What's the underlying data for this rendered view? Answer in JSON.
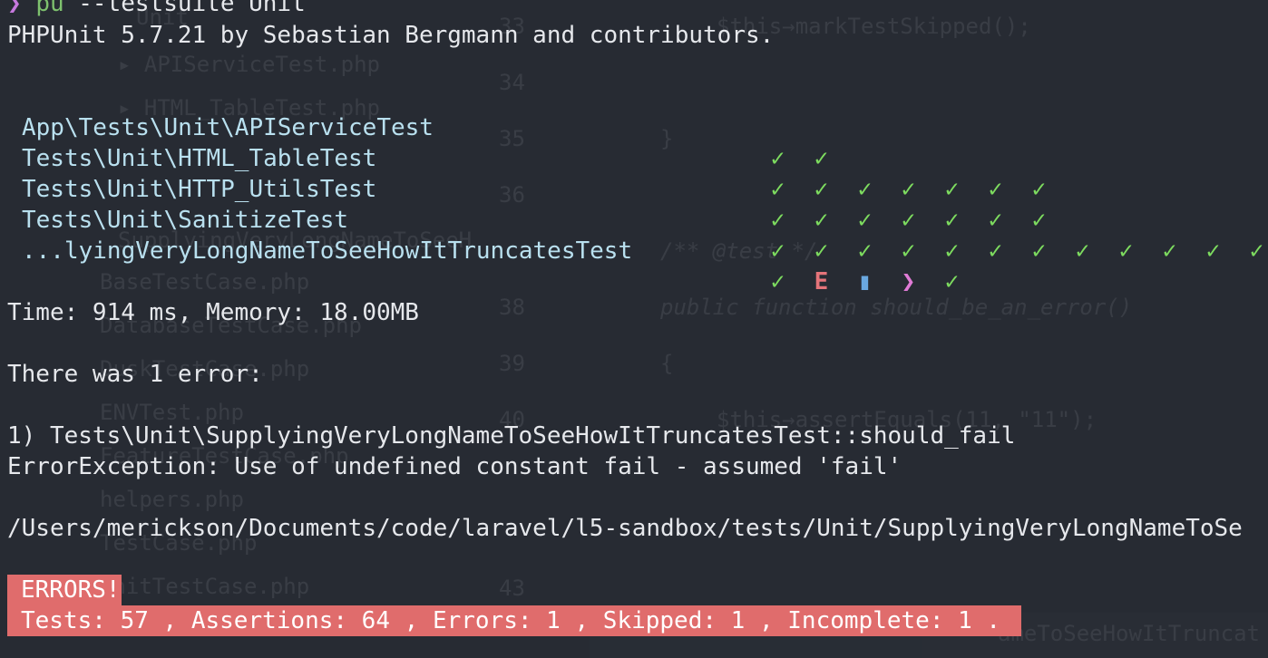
{
  "terminal": {
    "prompt_symbol": "❯",
    "command_alias": "pu",
    "command_args": "--testsuite Unit",
    "version_line": "PHPUnit 5.7.21 by Sebastian Bergmann and contributors.",
    "suites": [
      {
        "name": "App\\Tests\\Unit\\APIServiceTest",
        "results": [
          "✓",
          "✓"
        ]
      },
      {
        "name": "Tests\\Unit\\HTML_TableTest",
        "results": [
          "✓",
          "✓",
          "✓",
          "✓",
          "✓",
          "✓",
          "✓"
        ]
      },
      {
        "name": "Tests\\Unit\\HTTP_UtilsTest",
        "results": [
          "✓",
          "✓",
          "✓",
          "✓",
          "✓",
          "✓",
          "✓"
        ]
      },
      {
        "name": "Tests\\Unit\\SanitizeTest",
        "results": [
          "✓",
          "✓",
          "✓",
          "✓",
          "✓",
          "✓",
          "✓",
          "✓",
          "✓",
          "✓",
          "✓",
          "✓",
          "✓"
        ]
      },
      {
        "name": "...lyingVeryLongNameToSeeHowItTruncatesTest",
        "results": [
          "✓",
          "E",
          "▮",
          "❯",
          "✓"
        ]
      }
    ],
    "time_memory": "Time: 914 ms, Memory: 18.00MB",
    "error_count_line": "There was 1 error:",
    "error_title": "1) Tests\\Unit\\SupplyingVeryLongNameToSeeHowItTruncatesTest::should_fail",
    "error_message": "ErrorException: Use of undefined constant fail - assumed 'fail'",
    "error_path": "/Users/merickson/Documents/code/laravel/l5-sandbox/tests/Unit/SupplyingVeryLongNameToSe",
    "summary_banner": "ERRORS!",
    "summary_stats": "Tests: 57 , Assertions: 64 , Errors: 1 , Skipped: 1 , Incomplete: 1 ."
  },
  "colors": {
    "background": "#272b33",
    "pass": "#7ddc5f",
    "error": "#e5747a",
    "skipped": "#6aa8e0",
    "incomplete": "#e07bd6",
    "banner": "#e06c6c"
  }
}
